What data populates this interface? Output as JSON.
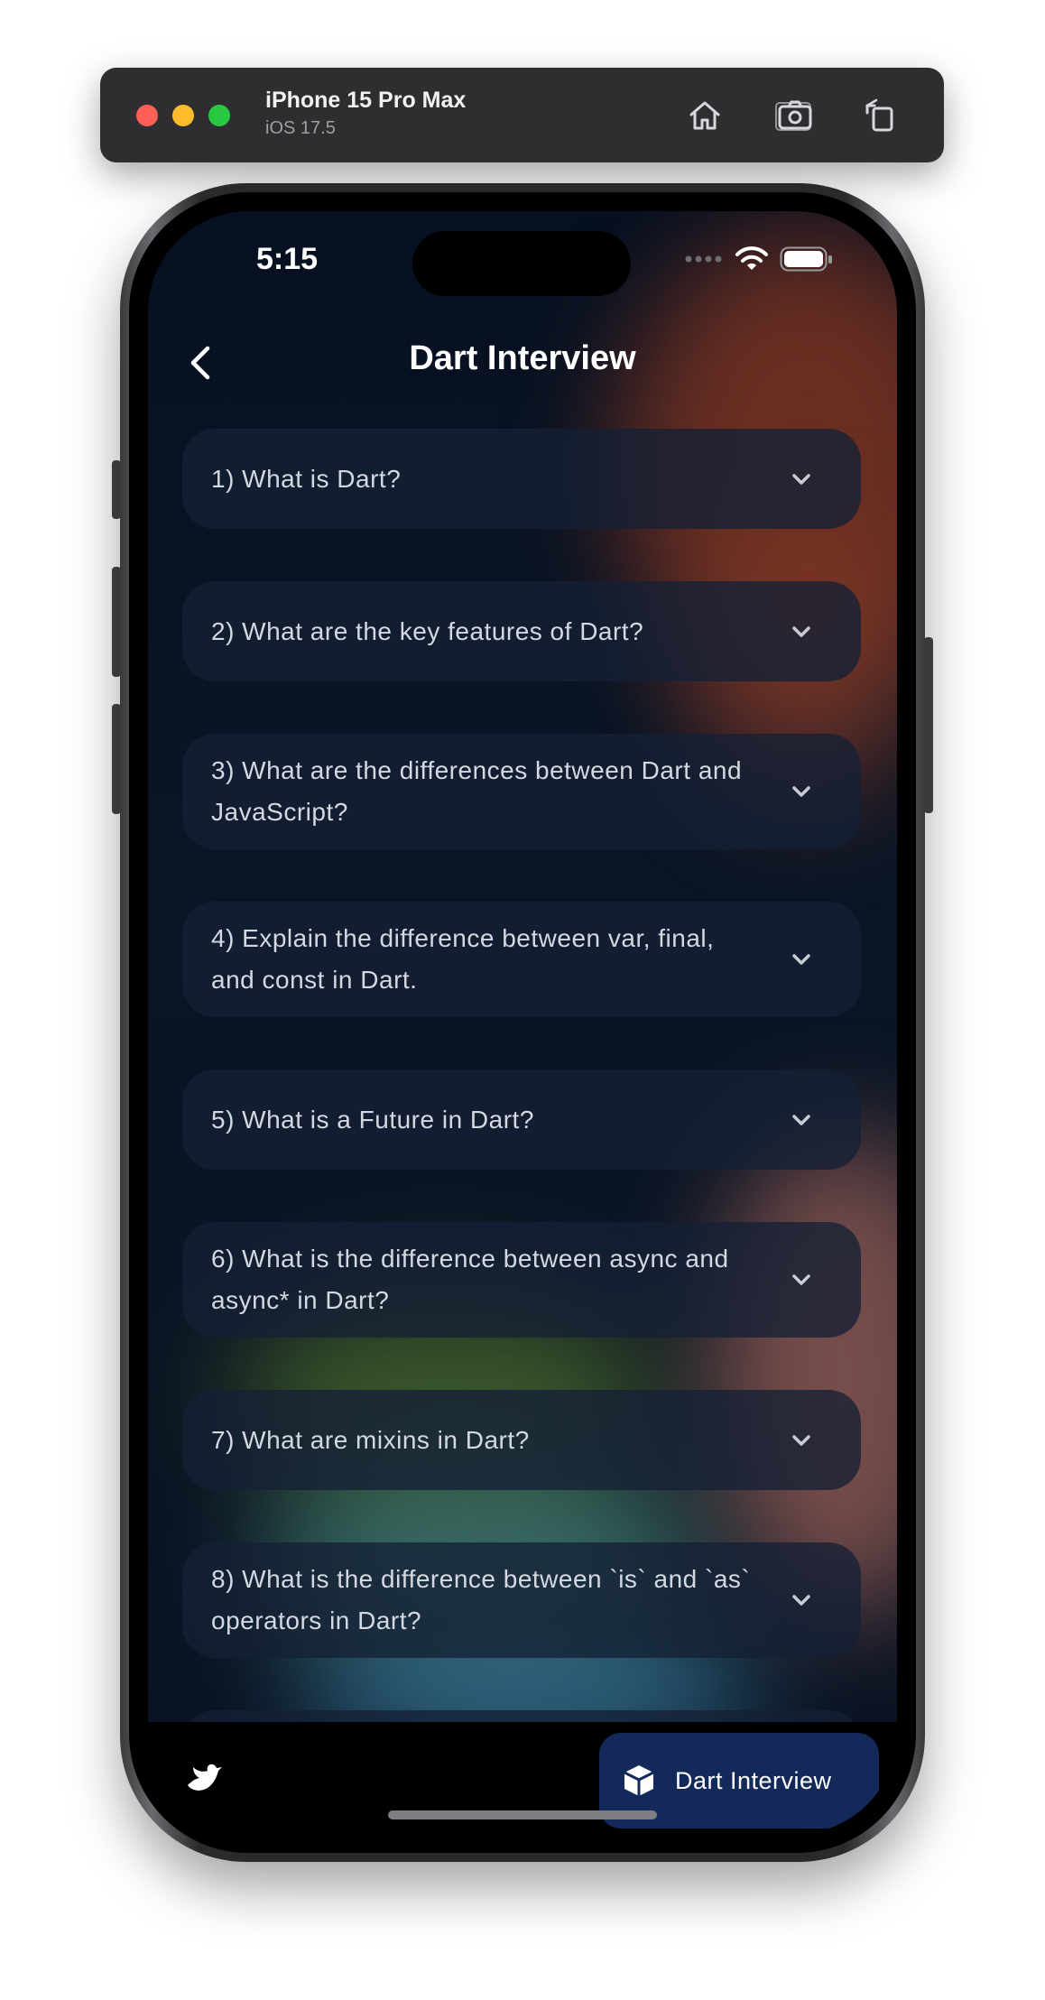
{
  "simulator": {
    "device_name": "iPhone 15 Pro Max",
    "os_version": "iOS 17.5",
    "buttons": [
      "home-icon",
      "screenshot-icon",
      "rotate-icon"
    ]
  },
  "status_bar": {
    "time": "5:15"
  },
  "nav": {
    "title": "Dart Interview"
  },
  "questions": [
    {
      "text": "1) What is Dart?"
    },
    {
      "text": "2) What are the key features of Dart?"
    },
    {
      "text": "3) What are the differences between Dart and JavaScript?"
    },
    {
      "text": "4) Explain the difference between var, final, and const in Dart."
    },
    {
      "text": "5) What is a Future in Dart?"
    },
    {
      "text": "6) What is the difference between async and async* in Dart?"
    },
    {
      "text": "7) What are mixins in Dart?"
    },
    {
      "text": "8) What is the difference between `is` and `as` operators in Dart?"
    }
  ],
  "bottom_bar": {
    "active_tab_label": "Dart Interview",
    "active_tab_icon": "box-icon",
    "left_icon": "dart-bird-icon"
  },
  "colors": {
    "background": "#061020",
    "card": "#14203a",
    "active_tab": "#12295a",
    "accent_warm": "#8a3a28",
    "accent_green": "#5a7a3a",
    "accent_teal": "#4a8aa0"
  }
}
